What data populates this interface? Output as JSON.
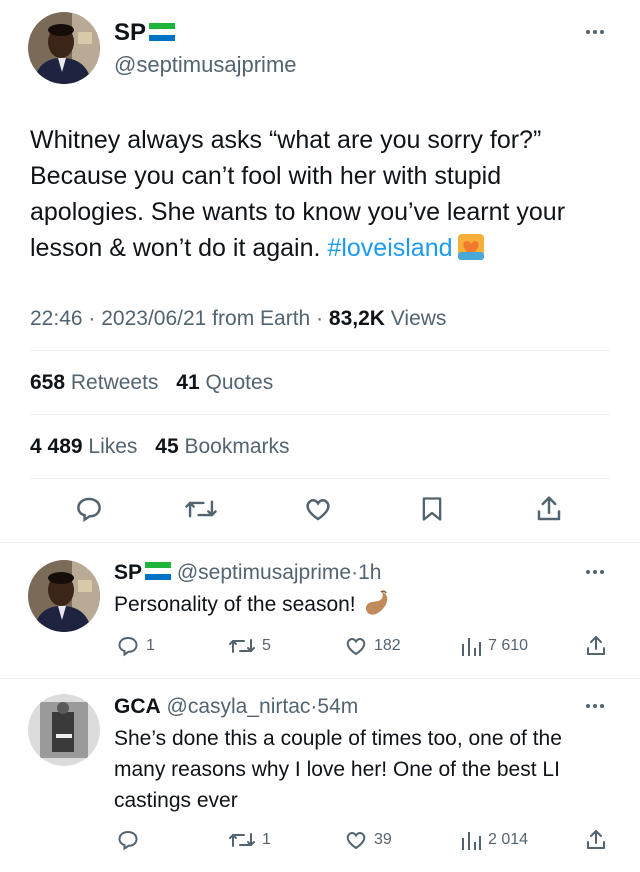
{
  "colors": {
    "link": "#1d9bf0",
    "muted": "#536471",
    "text": "#0f1419",
    "divider": "#eff3f4"
  },
  "main_tweet": {
    "display_name": "SP",
    "flag_icon": "sierra-leone-flag-icon",
    "handle": "@septimusajprime",
    "text_before_hashtag": "Whitney always asks “what are you sorry for?” Because you can’t fool with her with stupid apologies. She wants to know you’ve learnt your lesson & won’t do it again.",
    "hashtag": "#loveisland",
    "hashtag_emoji_icon": "love-island-heart-emoji",
    "time": "22:46",
    "date": "2023/06/21 from Earth",
    "views_count": "83,2K",
    "views_label": "Views",
    "retweets_count": "658",
    "retweets_label": "Retweets",
    "quotes_count": "41",
    "quotes_label": "Quotes",
    "likes_count": "4 489",
    "likes_label": "Likes",
    "bookmarks_count": "45",
    "bookmarks_label": "Bookmarks",
    "action_icons": [
      "reply-icon",
      "retweet-icon",
      "like-icon",
      "bookmark-icon",
      "share-icon"
    ]
  },
  "replies": [
    {
      "display_name": "SP",
      "handle": "@septimusajprime",
      "time": "1h",
      "text": "Personality of the season!",
      "emoji_icon": "pinching-hand-emoji",
      "reply_count": "1",
      "retweet_count": "5",
      "like_count": "182",
      "view_count": "7 610"
    },
    {
      "display_name": "GCA",
      "handle": "@casyla_nirtac",
      "time": "54m",
      "text": "She’s done this a couple of times too, one of the many reasons why I love her! One of the best LI castings ever",
      "reply_count": "",
      "retweet_count": "1",
      "like_count": "39",
      "view_count": "2 014"
    }
  ]
}
